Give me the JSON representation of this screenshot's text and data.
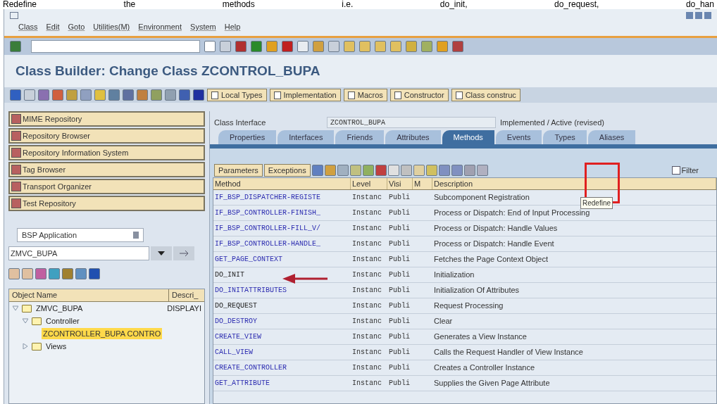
{
  "caption": [
    "Redefine",
    "the",
    "methods",
    "i.e.",
    "do_init,",
    "do_request,",
    "do_han"
  ],
  "menu": [
    "Class",
    "Edit",
    "Goto",
    "Utilities(M)",
    "Environment",
    "System",
    "Help"
  ],
  "title": "Class Builder: Change Class ZCONTROL_BUPA",
  "app_toolbar": [
    "Local Types",
    "Implementation",
    "Macros",
    "Constructor",
    "Class construc"
  ],
  "repository_items": [
    "MIME Repository",
    "Repository Browser",
    "Repository Information System",
    "Tag Browser",
    "Transport Organizer",
    "Test Repository"
  ],
  "object_type": {
    "value": "BSP Application"
  },
  "object_name": {
    "value": "ZMVC_BUPA"
  },
  "tree": {
    "columns": [
      "Object Name",
      "Descri_"
    ],
    "nodes": [
      {
        "label": "ZMVC_BUPA",
        "description": "DISPLAYI",
        "expanded": true,
        "selected": false,
        "children": [
          {
            "label": "Controller",
            "expanded": true,
            "selected": false,
            "children": [
              {
                "label": "ZCONTROLLER_BUPA CONTRO",
                "selected": true
              }
            ]
          },
          {
            "label": "Views",
            "expanded": false,
            "selected": false
          }
        ]
      }
    ]
  },
  "class_interface": {
    "label": "Class Interface",
    "value": "ZCONTROL_BUPA",
    "status": "Implemented / Active (revised)"
  },
  "tabs": [
    {
      "label": "Properties",
      "selected": false
    },
    {
      "label": "Interfaces",
      "selected": false
    },
    {
      "label": "Friends",
      "selected": false
    },
    {
      "label": "Attributes",
      "selected": false
    },
    {
      "label": "Methods",
      "selected": true
    },
    {
      "label": "Events",
      "selected": false
    },
    {
      "label": "Types",
      "selected": false
    },
    {
      "label": "Aliases",
      "selected": false
    }
  ],
  "methods_toolbar": {
    "buttons": [
      "Parameters",
      "Exceptions"
    ],
    "filter": {
      "label": "Filter",
      "checked": false
    },
    "tooltip": "Redefine"
  },
  "table": {
    "columns": [
      "Method",
      "Level",
      "Visi",
      "M",
      "Description"
    ],
    "rows": [
      {
        "method": "IF_BSP_DISPATCHER-REGISTE",
        "level": "Instanc",
        "visi": "Publi",
        "description": "Subcomponent Registration",
        "color": "#2b2bb0"
      },
      {
        "method": "IF_BSP_CONTROLLER-FINISH_",
        "level": "Instanc",
        "visi": "Publi",
        "description": "Process or Dispatch: End of Input Processing",
        "color": "#2b2bb0"
      },
      {
        "method": "IF_BSP_CONTROLLER-FILL_V/",
        "level": "Instanc",
        "visi": "Publi",
        "description": "Process or Dispatch: Handle Values",
        "color": "#2b2bb0"
      },
      {
        "method": "IF_BSP_CONTROLLER-HANDLE_",
        "level": "Instanc",
        "visi": "Publi",
        "description": "Process or Dispatch: Handle Event",
        "color": "#2b2bb0"
      },
      {
        "method": "GET_PAGE_CONTEXT",
        "level": "Instanc",
        "visi": "Publi",
        "description": "Fetches the Page Context Object",
        "color": "#2b2bb0"
      },
      {
        "method": "DO_INIT",
        "level": "Instanc",
        "visi": "Publi",
        "description": "Initialization",
        "color": "#222222"
      },
      {
        "method": "DO_INITATTRIBUTES",
        "level": "Instanc",
        "visi": "Publi",
        "description": "Initialization Of Attributes",
        "color": "#2b2bb0"
      },
      {
        "method": "DO_REQUEST",
        "level": "Instanc",
        "visi": "Publi",
        "description": "Request Processing",
        "color": "#222222"
      },
      {
        "method": "DO_DESTROY",
        "level": "Instanc",
        "visi": "Publi",
        "description": "Clear",
        "color": "#2b2bb0"
      },
      {
        "method": "CREATE_VIEW",
        "level": "Instanc",
        "visi": "Publi",
        "description": "Generates a View Instance",
        "color": "#2b2bb0"
      },
      {
        "method": "CALL_VIEW",
        "level": "Instanc",
        "visi": "Publi",
        "description": "Calls the Request Handler of View Instance",
        "color": "#2b2bb0"
      },
      {
        "method": "CREATE_CONTROLLER",
        "level": "Instanc",
        "visi": "Publi",
        "description": "Creates a Controller Instance",
        "color": "#2b2bb0"
      },
      {
        "method": "GET_ATTRIBUTE",
        "level": "Instanc",
        "visi": "Publi",
        "description": "Supplies the Given Page Attribute",
        "color": "#2b2bb0"
      }
    ]
  }
}
